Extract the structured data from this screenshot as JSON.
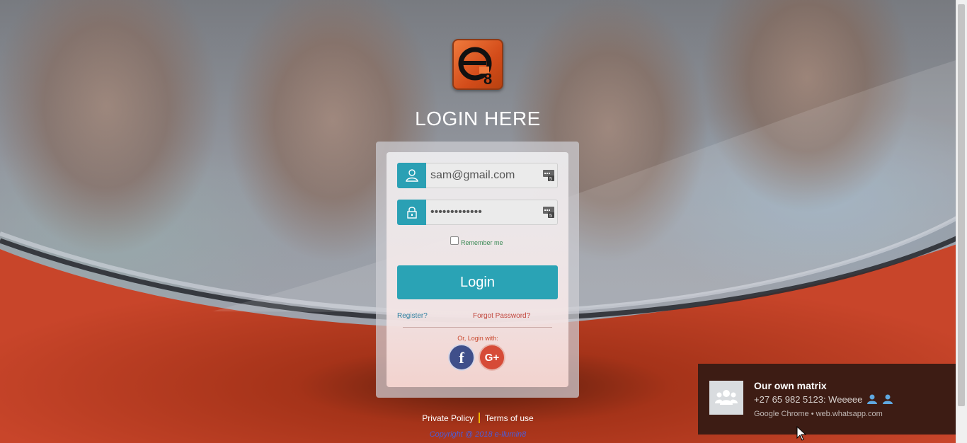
{
  "brand": {
    "logo_icon": "e8-logo-icon"
  },
  "heading": "LOGIN HERE",
  "form": {
    "email_value": "sam@gmail.com",
    "password_value": "•••••••••••••",
    "remember_label": "Remember me",
    "remember_checked": false,
    "login_label": "Login",
    "register_link": "Register?",
    "forgot_link": "Forgot Password?",
    "social_prompt": "Or, Login with:",
    "social": [
      {
        "name": "facebook",
        "glyph": "f"
      },
      {
        "name": "google-plus",
        "glyph": "G+"
      }
    ]
  },
  "footer": {
    "privacy": "Private Policy",
    "terms": "Terms of use",
    "copyright": "Copyright @ 2018 e-llumin8"
  },
  "notification": {
    "title": "Our own matrix",
    "message": "+27 65 982 5123: Weeeee",
    "source": "Google Chrome • web.whatsapp.com",
    "avatar_icon": "group-icon"
  },
  "colors": {
    "accent_teal": "#2aa3b5",
    "brand_orange": "#c8452a",
    "toast_bg": "#3d1c14"
  }
}
